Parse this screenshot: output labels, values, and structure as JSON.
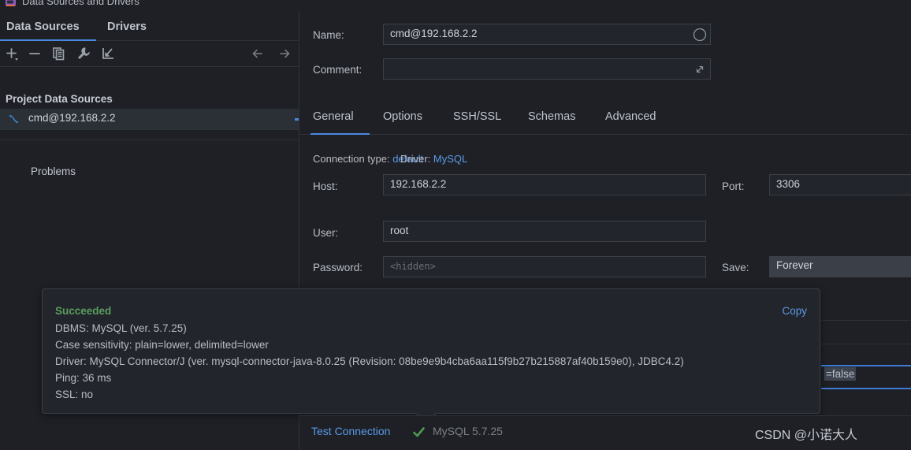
{
  "window": {
    "title": "Data Sources and Drivers",
    "icon": "datasource-window-icon"
  },
  "sidebar": {
    "tabs": [
      {
        "label": "Data Sources",
        "active": true
      },
      {
        "label": "Drivers",
        "active": false
      }
    ],
    "toolbar": [
      {
        "name": "add-button",
        "icon": "plus-icon"
      },
      {
        "name": "remove-button",
        "icon": "minus-icon"
      },
      {
        "name": "duplicate-button",
        "icon": "copy-icon"
      },
      {
        "name": "properties-button",
        "icon": "wrench-icon"
      },
      {
        "name": "import-button",
        "icon": "import-arrow-icon"
      },
      {
        "name": "back-button",
        "icon": "arrow-left-icon"
      },
      {
        "name": "forward-button",
        "icon": "arrow-right-icon"
      }
    ],
    "group_label": "Project Data Sources",
    "items": [
      {
        "label": "cmd@192.168.2.2",
        "icon": "mysql-dolphin-icon",
        "selected": true
      }
    ],
    "problems_label": "Problems"
  },
  "form": {
    "name_label": "Name:",
    "name_value": "cmd@192.168.2.2",
    "name_color_icon": "circle-outline-icon",
    "comment_label": "Comment:",
    "comment_value": "",
    "comment_expand_icon": "expand-diagonal-icon",
    "tabs": [
      {
        "label": "General",
        "active": true
      },
      {
        "label": "Options",
        "active": false
      },
      {
        "label": "SSH/SSL",
        "active": false
      },
      {
        "label": "Schemas",
        "active": false
      },
      {
        "label": "Advanced",
        "active": false
      }
    ],
    "connection_type_label": "Connection type:",
    "connection_type_value": "default",
    "driver_label": "Driver:",
    "driver_value": "MySQL",
    "host_label": "Host:",
    "host_value": "192.168.2.2",
    "port_label": "Port:",
    "port_value": "3306",
    "user_label": "User:",
    "user_value": "root",
    "password_label": "Password:",
    "password_placeholder": "<hidden>",
    "save_label": "Save:",
    "save_value": "Forever"
  },
  "advanced_grid": {
    "selected_cell_value": "=false"
  },
  "result_popup": {
    "status": "Succeeded",
    "copy_label": "Copy",
    "lines": [
      "DBMS: MySQL (ver. 5.7.25)",
      "Case sensitivity: plain=lower, delimited=lower",
      "Driver: MySQL Connector/J (ver. mysql-connector-java-8.0.25 (Revision: 08be9e9b4cba6aa115f9b27b215887af40b159e0), JDBC4.2)",
      "Ping: 36 ms",
      "SSL: no"
    ]
  },
  "bottom_bar": {
    "test_connection_label": "Test Connection",
    "status_icon": "green-check-icon",
    "version_text": "MySQL 5.7.25"
  },
  "watermark": {
    "text": "CSDN @小诺大人"
  },
  "colors": {
    "background": "#1e2026",
    "field_background": "#22252b",
    "accent_blue": "#4a88df",
    "link_blue": "#5b9ae8",
    "success_green": "#5a9e5f",
    "text": "#b9bdc5"
  }
}
